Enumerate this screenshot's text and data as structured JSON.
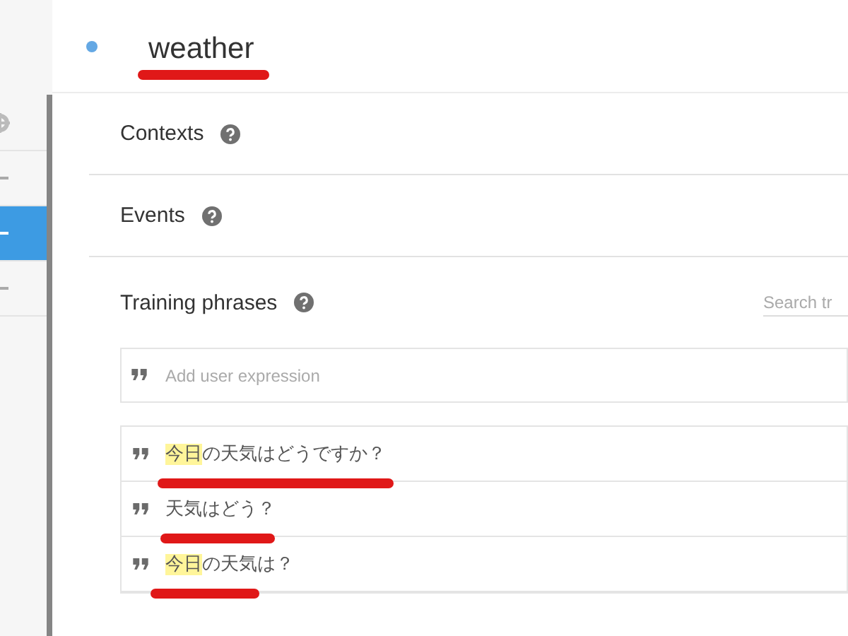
{
  "sidebar": {
    "items": [
      {
        "kind": "gear",
        "selected": false
      },
      {
        "kind": "dash",
        "selected": false
      },
      {
        "kind": "dash",
        "selected": true
      },
      {
        "kind": "dash",
        "selected": false
      }
    ]
  },
  "intent": {
    "title": "weather"
  },
  "sections": [
    {
      "title": "Contexts"
    },
    {
      "title": "Events"
    }
  ],
  "training_phrases": {
    "title": "Training phrases",
    "search": {
      "placeholder": "Search tr"
    },
    "add": {
      "placeholder": "Add user expression"
    },
    "phrases": [
      {
        "segments": [
          {
            "text": "今日",
            "highlighted": true
          },
          {
            "text": "の天気はどうですか？",
            "highlighted": false
          }
        ]
      },
      {
        "segments": [
          {
            "text": "天気はどう？",
            "highlighted": false
          }
        ]
      },
      {
        "segments": [
          {
            "text": "今日",
            "highlighted": true
          },
          {
            "text": "の天気は？",
            "highlighted": false
          }
        ]
      }
    ]
  }
}
